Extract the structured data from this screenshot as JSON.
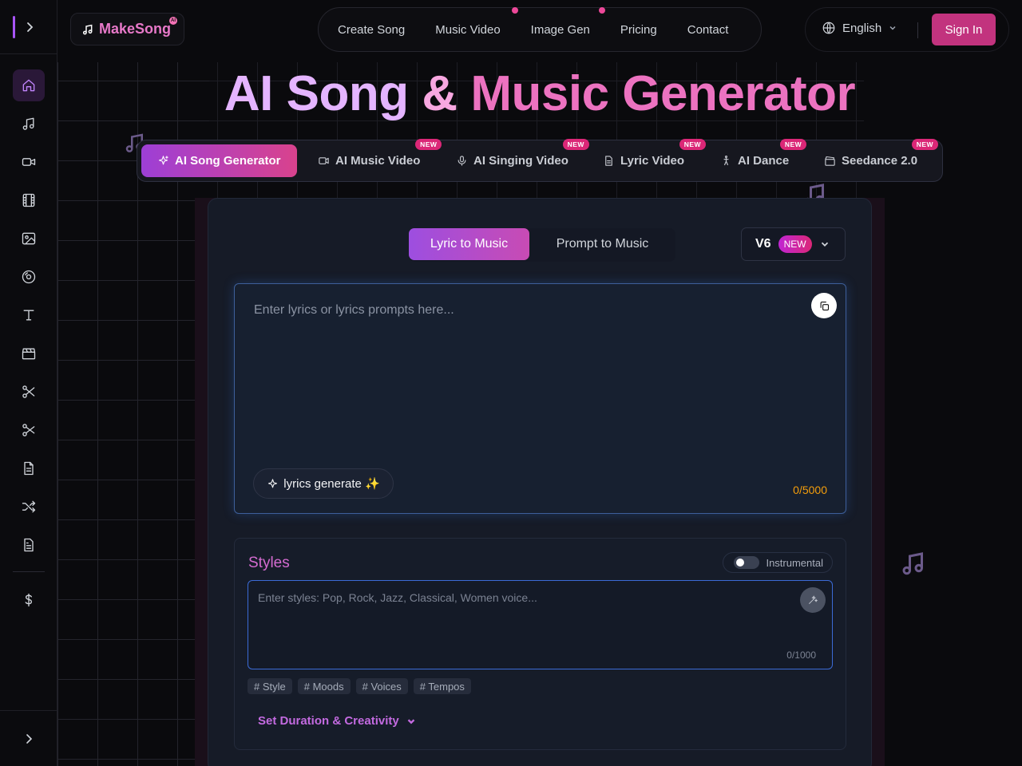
{
  "brand": {
    "name": "MakeSong",
    "ai_badge": "AI",
    "accent": "#ec4899"
  },
  "nav": {
    "items": [
      {
        "label": "Create Song",
        "dot": false
      },
      {
        "label": "Music Video",
        "dot": true
      },
      {
        "label": "Image Gen",
        "dot": true
      },
      {
        "label": "Pricing",
        "dot": false
      },
      {
        "label": "Contact",
        "dot": false
      }
    ],
    "language": "English",
    "signin": "Sign In"
  },
  "sidebar": {
    "items": [
      {
        "icon": "home-icon",
        "active": true
      },
      {
        "icon": "music-note-icon",
        "active": false
      },
      {
        "icon": "video-camera-icon",
        "active": false
      },
      {
        "icon": "film-icon",
        "active": false
      },
      {
        "icon": "image-icon",
        "active": false
      },
      {
        "icon": "vinyl-disc-icon",
        "active": false
      },
      {
        "icon": "text-icon",
        "active": false
      },
      {
        "icon": "clapperboard-icon",
        "active": false
      },
      {
        "icon": "scissors-icon",
        "active": false
      },
      {
        "icon": "scissors-alt-icon",
        "active": false
      },
      {
        "icon": "document-icon",
        "active": false
      },
      {
        "icon": "shuffle-icon",
        "active": false
      },
      {
        "icon": "file-text-icon",
        "active": false
      },
      {
        "icon": "dollar-icon",
        "active": false
      }
    ]
  },
  "hero": {
    "title_part1": "AI Song",
    "title_amp": "&",
    "title_part2": "Music Generator"
  },
  "feature_tabs": [
    {
      "label": "AI Song Generator",
      "icon": "sparkle-icon",
      "new": false,
      "active": true
    },
    {
      "label": "AI Music Video",
      "icon": "video-icon",
      "new": true,
      "active": false
    },
    {
      "label": "AI Singing Video",
      "icon": "microphone-icon",
      "new": true,
      "active": false
    },
    {
      "label": "Lyric Video",
      "icon": "document-icon",
      "new": true,
      "active": false
    },
    {
      "label": "AI Dance",
      "icon": "dancer-icon",
      "new": true,
      "active": false
    },
    {
      "label": "Seedance 2.0",
      "icon": "clapperboard-icon",
      "new": true,
      "active": false
    }
  ],
  "new_label": "NEW",
  "generator": {
    "modes": [
      "Lyric to Music",
      "Prompt to Music"
    ],
    "active_mode": "Lyric to Music",
    "version": "V6",
    "version_badge": "NEW",
    "lyrics_placeholder": "Enter lyrics or lyrics prompts here...",
    "lyrics_value": "",
    "lyrics_button": "lyrics generate ✨",
    "lyrics_count": "0/5000",
    "styles_title": "Styles",
    "instrumental_label": "Instrumental",
    "styles_placeholder": "Enter styles: Pop, Rock, Jazz, Classical, Women voice...",
    "styles_count": "0/1000",
    "tags": [
      "# Style",
      "# Moods",
      "# Voices",
      "# Tempos"
    ],
    "duration_label": "Set Duration & Creativity"
  }
}
